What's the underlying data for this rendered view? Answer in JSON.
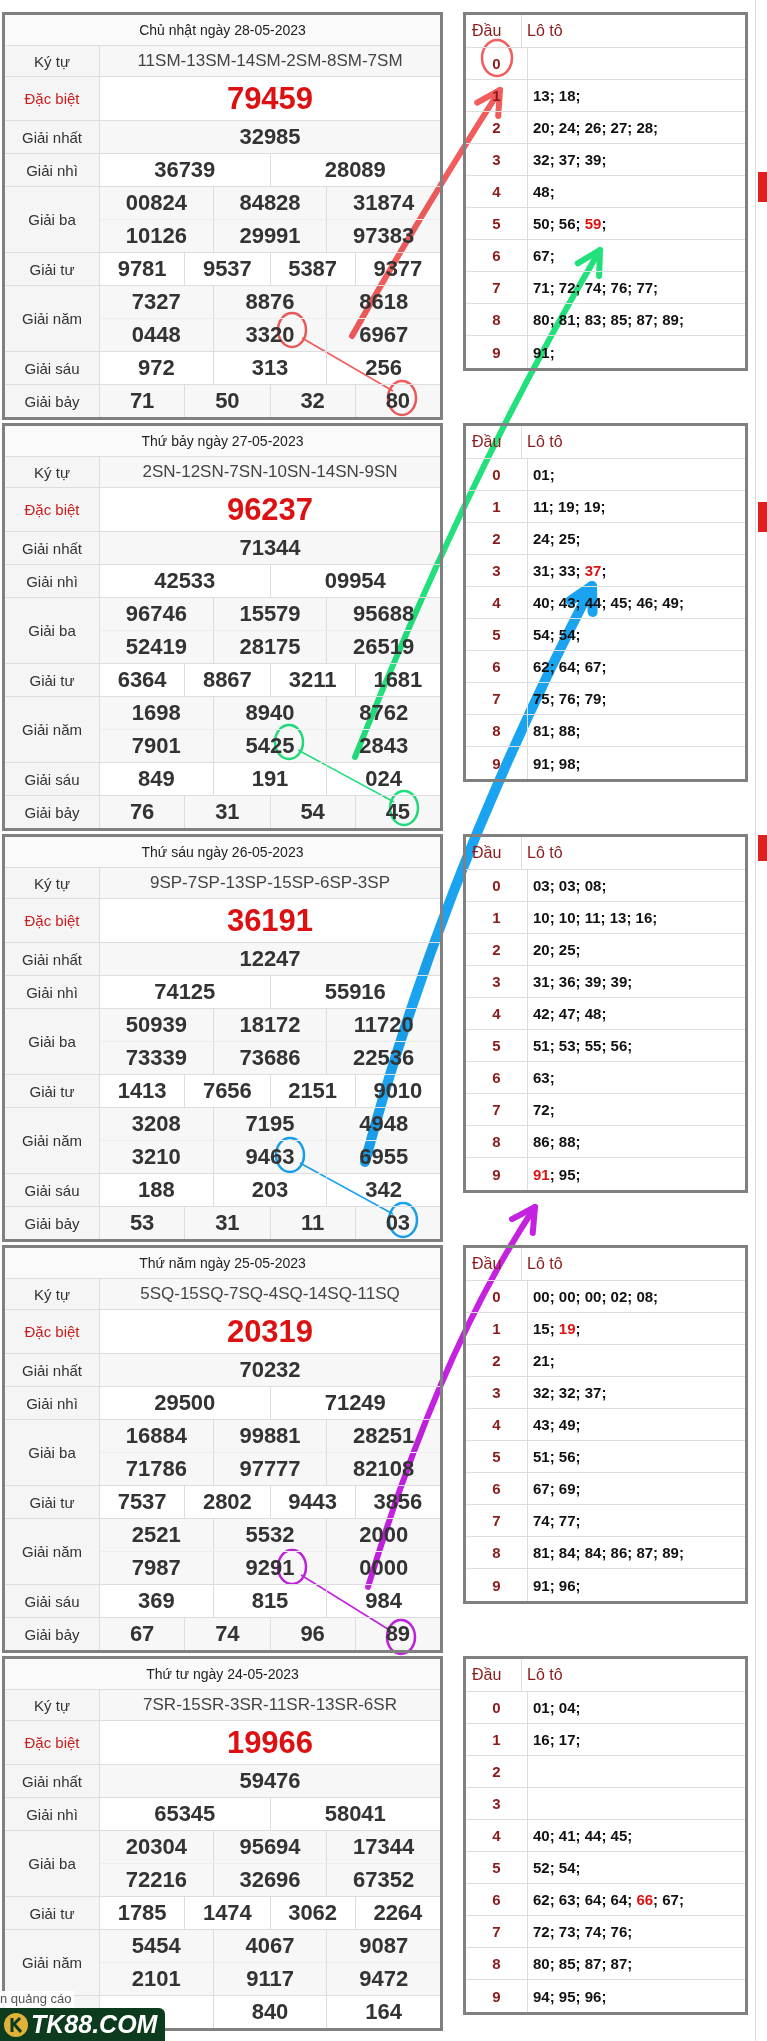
{
  "days": [
    {
      "title": "Chủ nhật ngày 28-05-2023",
      "rows": [
        {
          "kind": "code",
          "label": "Ký tự",
          "lines": [
            [
              "11SM-13SM-14SM-2SM-8SM-7SM"
            ]
          ]
        },
        {
          "kind": "special",
          "label": "Đặc biệt",
          "lines": [
            [
              "79459"
            ]
          ]
        },
        {
          "kind": "prize",
          "label": "Giải nhất",
          "lines": [
            [
              "32985"
            ]
          ]
        },
        {
          "kind": "prize",
          "label": "Giải nhì",
          "lines": [
            [
              "36739",
              "28089"
            ]
          ]
        },
        {
          "kind": "prize",
          "label": "Giải ba",
          "lines": [
            [
              "00824",
              "84828",
              "31874"
            ],
            [
              "10126",
              "29991",
              "97383"
            ]
          ]
        },
        {
          "kind": "prize",
          "label": "Giải tư",
          "lines": [
            [
              "9781",
              "9537",
              "5387",
              "9377"
            ]
          ]
        },
        {
          "kind": "prize",
          "label": "Giải năm",
          "lines": [
            [
              "7327",
              "8876",
              "8618"
            ],
            [
              "0448",
              "3320",
              "6967"
            ]
          ]
        },
        {
          "kind": "prize",
          "label": "Giải sáu",
          "lines": [
            [
              "972",
              "313",
              "256"
            ]
          ]
        },
        {
          "kind": "prize",
          "label": "Giải bảy",
          "lines": [
            [
              "71",
              "50",
              "32",
              "80"
            ]
          ]
        }
      ],
      "loto": {
        "head_label": "Đầu",
        "numbers_label": "Lô tô",
        "rows": [
          {
            "head": "0"
          },
          {
            "head": "1",
            "segments": [
              {
                "text": "13; 18;",
                "highlighted": false
              }
            ]
          },
          {
            "head": "2",
            "segments": [
              {
                "text": "20; 24; 26; 27; 28;",
                "highlighted": false
              }
            ]
          },
          {
            "head": "3",
            "segments": [
              {
                "text": "32; 37; 39;",
                "highlighted": false
              }
            ]
          },
          {
            "head": "4",
            "segments": [
              {
                "text": "48;",
                "highlighted": false
              }
            ]
          },
          {
            "head": "5",
            "segments": [
              {
                "text": "50; 56; ",
                "highlighted": false
              },
              {
                "text": "59",
                "highlighted": true
              },
              {
                "text": ";",
                "highlighted": false
              }
            ]
          },
          {
            "head": "6",
            "segments": [
              {
                "text": "67;",
                "highlighted": false
              }
            ]
          },
          {
            "head": "7",
            "segments": [
              {
                "text": "71; 72; 74; 76; 77;",
                "highlighted": false
              }
            ]
          },
          {
            "head": "8",
            "segments": [
              {
                "text": "80; 81; 83; 85; 87; 89;",
                "highlighted": false
              }
            ]
          },
          {
            "head": "9",
            "segments": [
              {
                "text": "91;",
                "highlighted": false
              }
            ]
          }
        ]
      }
    },
    {
      "title": "Thứ bảy ngày 27-05-2023",
      "rows": [
        {
          "kind": "code",
          "label": "Ký tự",
          "lines": [
            [
              "2SN-12SN-7SN-10SN-14SN-9SN"
            ]
          ]
        },
        {
          "kind": "special",
          "label": "Đặc biệt",
          "lines": [
            [
              "96237"
            ]
          ]
        },
        {
          "kind": "prize",
          "label": "Giải nhất",
          "lines": [
            [
              "71344"
            ]
          ]
        },
        {
          "kind": "prize",
          "label": "Giải nhì",
          "lines": [
            [
              "42533",
              "09954"
            ]
          ]
        },
        {
          "kind": "prize",
          "label": "Giải ba",
          "lines": [
            [
              "96746",
              "15579",
              "95688"
            ],
            [
              "52419",
              "28175",
              "26519"
            ]
          ]
        },
        {
          "kind": "prize",
          "label": "Giải tư",
          "lines": [
            [
              "6364",
              "8867",
              "3211",
              "1681"
            ]
          ]
        },
        {
          "kind": "prize",
          "label": "Giải năm",
          "lines": [
            [
              "1698",
              "8940",
              "8762"
            ],
            [
              "7901",
              "5425",
              "2843"
            ]
          ]
        },
        {
          "kind": "prize",
          "label": "Giải sáu",
          "lines": [
            [
              "849",
              "191",
              "024"
            ]
          ]
        },
        {
          "kind": "prize",
          "label": "Giải bảy",
          "lines": [
            [
              "76",
              "31",
              "54",
              "45"
            ]
          ]
        }
      ],
      "loto": {
        "head_label": "Đầu",
        "numbers_label": "Lô tô",
        "rows": [
          {
            "head": "0",
            "segments": [
              {
                "text": "01;",
                "highlighted": false
              }
            ]
          },
          {
            "head": "1",
            "segments": [
              {
                "text": "11; 19; 19;",
                "highlighted": false
              }
            ]
          },
          {
            "head": "2",
            "segments": [
              {
                "text": "24; 25;",
                "highlighted": false
              }
            ]
          },
          {
            "head": "3",
            "segments": [
              {
                "text": "31; 33; ",
                "highlighted": false
              },
              {
                "text": "37",
                "highlighted": true
              },
              {
                "text": ";",
                "highlighted": false
              }
            ]
          },
          {
            "head": "4",
            "segments": [
              {
                "text": "40; 43; 44; 45; 46; 49;",
                "highlighted": false
              }
            ]
          },
          {
            "head": "5",
            "segments": [
              {
                "text": "54; 54;",
                "highlighted": false
              }
            ]
          },
          {
            "head": "6",
            "segments": [
              {
                "text": "62; 64; 67;",
                "highlighted": false
              }
            ]
          },
          {
            "head": "7",
            "segments": [
              {
                "text": "75; 76; 79;",
                "highlighted": false
              }
            ]
          },
          {
            "head": "8",
            "segments": [
              {
                "text": "81; 88;",
                "highlighted": false
              }
            ]
          },
          {
            "head": "9",
            "segments": [
              {
                "text": "91; 98;",
                "highlighted": false
              }
            ]
          }
        ]
      }
    },
    {
      "title": "Thứ sáu ngày 26-05-2023",
      "rows": [
        {
          "kind": "code",
          "label": "Ký tự",
          "lines": [
            [
              "9SP-7SP-13SP-15SP-6SP-3SP"
            ]
          ]
        },
        {
          "kind": "special",
          "label": "Đặc biệt",
          "lines": [
            [
              "36191"
            ]
          ]
        },
        {
          "kind": "prize",
          "label": "Giải nhất",
          "lines": [
            [
              "12247"
            ]
          ]
        },
        {
          "kind": "prize",
          "label": "Giải nhì",
          "lines": [
            [
              "74125",
              "55916"
            ]
          ]
        },
        {
          "kind": "prize",
          "label": "Giải ba",
          "lines": [
            [
              "50939",
              "18172",
              "11720"
            ],
            [
              "73339",
              "73686",
              "22536"
            ]
          ]
        },
        {
          "kind": "prize",
          "label": "Giải tư",
          "lines": [
            [
              "1413",
              "7656",
              "2151",
              "9010"
            ]
          ]
        },
        {
          "kind": "prize",
          "label": "Giải năm",
          "lines": [
            [
              "3208",
              "7195",
              "4948"
            ],
            [
              "3210",
              "9463",
              "6955"
            ]
          ]
        },
        {
          "kind": "prize",
          "label": "Giải sáu",
          "lines": [
            [
              "188",
              "203",
              "342"
            ]
          ]
        },
        {
          "kind": "prize",
          "label": "Giải bảy",
          "lines": [
            [
              "53",
              "31",
              "11",
              "03"
            ]
          ]
        }
      ],
      "loto": {
        "head_label": "Đầu",
        "numbers_label": "Lô tô",
        "rows": [
          {
            "head": "0",
            "segments": [
              {
                "text": "03; 03; 08;",
                "highlighted": false
              }
            ]
          },
          {
            "head": "1",
            "segments": [
              {
                "text": "10; 10; 11; 13; 16;",
                "highlighted": false
              }
            ]
          },
          {
            "head": "2",
            "segments": [
              {
                "text": "20; 25;",
                "highlighted": false
              }
            ]
          },
          {
            "head": "3",
            "segments": [
              {
                "text": "31; 36; 39; 39;",
                "highlighted": false
              }
            ]
          },
          {
            "head": "4",
            "segments": [
              {
                "text": "42; 47; 48;",
                "highlighted": false
              }
            ]
          },
          {
            "head": "5",
            "segments": [
              {
                "text": "51; 53; 55; 56;",
                "highlighted": false
              }
            ]
          },
          {
            "head": "6",
            "segments": [
              {
                "text": "63;",
                "highlighted": false
              }
            ]
          },
          {
            "head": "7",
            "segments": [
              {
                "text": "72;",
                "highlighted": false
              }
            ]
          },
          {
            "head": "8",
            "segments": [
              {
                "text": "86; 88;",
                "highlighted": false
              }
            ]
          },
          {
            "head": "9",
            "segments": [
              {
                "text": "91",
                "highlighted": true
              },
              {
                "text": "; 95;",
                "highlighted": false
              }
            ]
          }
        ]
      }
    },
    {
      "title": "Thứ năm ngày 25-05-2023",
      "rows": [
        {
          "kind": "code",
          "label": "Ký tự",
          "lines": [
            [
              "5SQ-15SQ-7SQ-4SQ-14SQ-11SQ"
            ]
          ]
        },
        {
          "kind": "special",
          "label": "Đặc biệt",
          "lines": [
            [
              "20319"
            ]
          ]
        },
        {
          "kind": "prize",
          "label": "Giải nhất",
          "lines": [
            [
              "70232"
            ]
          ]
        },
        {
          "kind": "prize",
          "label": "Giải nhì",
          "lines": [
            [
              "29500",
              "71249"
            ]
          ]
        },
        {
          "kind": "prize",
          "label": "Giải ba",
          "lines": [
            [
              "16884",
              "99881",
              "28251"
            ],
            [
              "71786",
              "97777",
              "82108"
            ]
          ]
        },
        {
          "kind": "prize",
          "label": "Giải tư",
          "lines": [
            [
              "7537",
              "2802",
              "9443",
              "3856"
            ]
          ]
        },
        {
          "kind": "prize",
          "label": "Giải năm",
          "lines": [
            [
              "2521",
              "5532",
              "2000"
            ],
            [
              "7987",
              "9291",
              "0000"
            ]
          ]
        },
        {
          "kind": "prize",
          "label": "Giải sáu",
          "lines": [
            [
              "369",
              "815",
              "984"
            ]
          ]
        },
        {
          "kind": "prize",
          "label": "Giải bảy",
          "lines": [
            [
              "67",
              "74",
              "96",
              "89"
            ]
          ]
        }
      ],
      "loto": {
        "head_label": "Đầu",
        "numbers_label": "Lô tô",
        "rows": [
          {
            "head": "0",
            "segments": [
              {
                "text": "00; 00; 00; 02; 08;",
                "highlighted": false
              }
            ]
          },
          {
            "head": "1",
            "segments": [
              {
                "text": "15; ",
                "highlighted": false
              },
              {
                "text": "19",
                "highlighted": true
              },
              {
                "text": ";",
                "highlighted": false
              }
            ]
          },
          {
            "head": "2",
            "segments": [
              {
                "text": "21;",
                "highlighted": false
              }
            ]
          },
          {
            "head": "3",
            "segments": [
              {
                "text": "32; 32; 37;",
                "highlighted": false
              }
            ]
          },
          {
            "head": "4",
            "segments": [
              {
                "text": "43; 49;",
                "highlighted": false
              }
            ]
          },
          {
            "head": "5",
            "segments": [
              {
                "text": "51; 56;",
                "highlighted": false
              }
            ]
          },
          {
            "head": "6",
            "segments": [
              {
                "text": "67; 69;",
                "highlighted": false
              }
            ]
          },
          {
            "head": "7",
            "segments": [
              {
                "text": "74; 77;",
                "highlighted": false
              }
            ]
          },
          {
            "head": "8",
            "segments": [
              {
                "text": "81; 84; 84; 86; 87; 89;",
                "highlighted": false
              }
            ]
          },
          {
            "head": "9",
            "segments": [
              {
                "text": "91; 96;",
                "highlighted": false
              }
            ]
          }
        ]
      }
    },
    {
      "title": "Thứ tư ngày 24-05-2023",
      "rows": [
        {
          "kind": "code",
          "label": "Ký tự",
          "lines": [
            [
              "7SR-15SR-3SR-11SR-13SR-6SR"
            ]
          ]
        },
        {
          "kind": "special",
          "label": "Đặc biệt",
          "lines": [
            [
              "19966"
            ]
          ]
        },
        {
          "kind": "prize",
          "label": "Giải nhất",
          "lines": [
            [
              "59476"
            ]
          ]
        },
        {
          "kind": "prize",
          "label": "Giải nhì",
          "lines": [
            [
              "65345",
              "58041"
            ]
          ]
        },
        {
          "kind": "prize",
          "label": "Giải ba",
          "lines": [
            [
              "20304",
              "95694",
              "17344"
            ],
            [
              "72216",
              "32696",
              "67352"
            ]
          ]
        },
        {
          "kind": "prize",
          "label": "Giải tư",
          "lines": [
            [
              "1785",
              "1474",
              "3062",
              "2264"
            ]
          ]
        },
        {
          "kind": "prize",
          "label": "Giải năm",
          "lines": [
            [
              "5454",
              "4067",
              "9087"
            ],
            [
              "2101",
              "9117",
              "9472"
            ]
          ]
        },
        {
          "kind": "partial",
          "lines": [
            [
              "840",
              "164"
            ]
          ]
        }
      ],
      "loto": {
        "head_label": "Đầu",
        "numbers_label": "Lô tô",
        "rows": [
          {
            "head": "0",
            "segments": [
              {
                "text": "01; 04;",
                "highlighted": false
              }
            ]
          },
          {
            "head": "1",
            "segments": [
              {
                "text": "16; 17;",
                "highlighted": false
              }
            ]
          },
          {
            "head": "2"
          },
          {
            "head": "3"
          },
          {
            "head": "4",
            "segments": [
              {
                "text": "40; 41; 44; 45;",
                "highlighted": false
              }
            ]
          },
          {
            "head": "5",
            "segments": [
              {
                "text": "52; 54;",
                "highlighted": false
              }
            ]
          },
          {
            "head": "6",
            "segments": [
              {
                "text": "62; 63; 64; 64; ",
                "highlighted": false
              },
              {
                "text": "66",
                "highlighted": true
              },
              {
                "text": "; 67;",
                "highlighted": false
              }
            ]
          },
          {
            "head": "7",
            "segments": [
              {
                "text": "72; 73; 74; 76;",
                "highlighted": false
              }
            ]
          },
          {
            "head": "8",
            "segments": [
              {
                "text": "80; 85; 87; 87;",
                "highlighted": false
              }
            ]
          },
          {
            "head": "9",
            "segments": [
              {
                "text": "94; 95; 96;",
                "highlighted": false
              }
            ]
          }
        ]
      }
    }
  ],
  "ad_banner": {
    "hide_label": "n quảng cáo",
    "logo": "TK88.COM"
  }
}
